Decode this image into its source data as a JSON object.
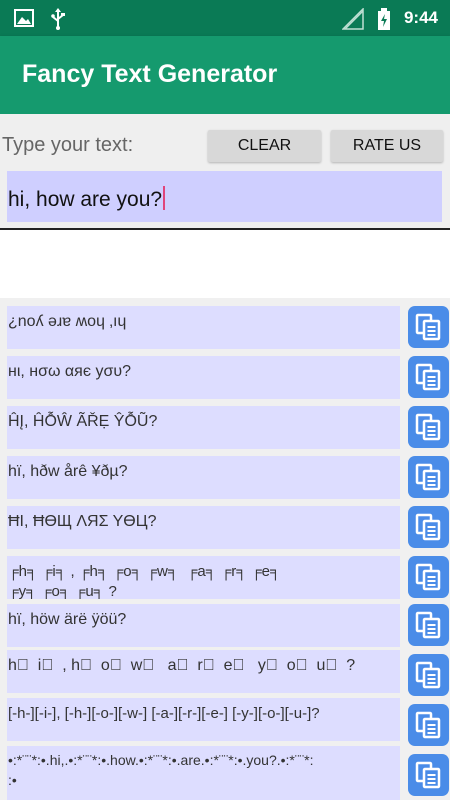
{
  "status_bar": {
    "time": "9:44",
    "icons": [
      "image-icon",
      "usb-icon",
      "signal-icon",
      "battery-icon"
    ]
  },
  "app_bar": {
    "title": "Fancy Text Generator"
  },
  "input": {
    "label": "Type your text:",
    "clear_label": "CLEAR",
    "rate_label": "RATE US",
    "value": "hi, how are you?"
  },
  "results": [
    {
      "text": "¿noʎ ǝɹɐ ʍoɥ ‚ıɥ"
    },
    {
      "text": "нι, нσω αяє уσυ?"
    },
    {
      "text": "ĤĮ, ĤỖŴ ÃŘẸ ŶỖŨ?"
    },
    {
      "text": "hï, hðw årê ¥ðµ?"
    },
    {
      "text": "ĦI, ĦӨЩ ΛЯΣ ΥӨЦ?"
    },
    {
      "text": "╒h╕ ╒i╕ , ╒h╕ ╒o╕ ╒w╕  ╒a╕ ╒r╕ ╒e╕\n╒y╕ ╒o╕ ╒u╕ ?"
    },
    {
      "text": "hï, höw ärë ÿöü?"
    },
    {
      "text": "h⃣  i⃣  , h⃣  o⃣  w⃣   a⃣  r⃣  e⃣   y⃣  o⃣  u⃣  ?"
    },
    {
      "text": "[-h-][-i-], [-h-][-o-][-w-] [-a-][-r-][-e-] [-y-][-o-][-u-]?"
    },
    {
      "text": "•:*¨¨*:•.hi,.•:*¨¨*:•.how.•:*¨¨*:•.are.•:*¨¨*:•.you?.•:*¨¨*:\n:•"
    }
  ],
  "colors": {
    "status_bar": "#0a7a55",
    "app_bar": "#159a6e",
    "input_bg": "#cfcfff",
    "row_bg": "#ddddff",
    "copy_button": "#4a8ce8"
  }
}
